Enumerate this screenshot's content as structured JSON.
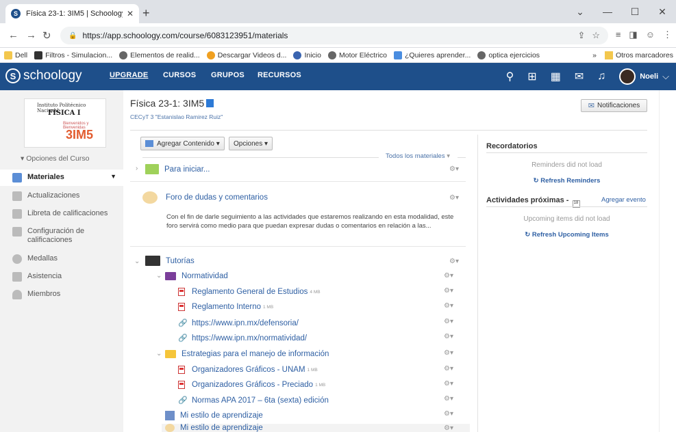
{
  "browser": {
    "tab_title": "Física 23-1: 3IM5 | Schoology",
    "tab_favicon": "S",
    "url": "https://app.schoology.com/course/6083123951/materials",
    "bookmarks": [
      "Dell",
      "Filtros - Simulacion...",
      "Elementos de realid...",
      "Descargar Videos d...",
      "Inicio",
      "Motor Eléctrico",
      "¿Quieres aprender...",
      "optica ejercicios"
    ],
    "other_bookmarks": "Otros marcadores",
    "more": "»"
  },
  "nav": {
    "logo": "schoology",
    "links": [
      "UPGRADE",
      "CURSOS",
      "GRUPOS",
      "RECURSOS"
    ],
    "user": "Noeli"
  },
  "colors": {
    "nav_bg": "#1e4f8a",
    "link": "#2e5fa3",
    "sidebar_bg": "#f2f2f2"
  },
  "sidebar": {
    "course_pic": {
      "line1": "Instituto Politécnico Nacional",
      "line2": "FÍSICA I",
      "line3": "Bienvenidos y Bienvenidas",
      "line4": "3IM5"
    },
    "options": "Opciones del Curso",
    "items": [
      {
        "label": "Materiales",
        "icon": "materials-icon"
      },
      {
        "label": "Actualizaciones",
        "icon": "updates-icon"
      },
      {
        "label": "Libreta de calificaciones",
        "icon": "gradebook-icon"
      },
      {
        "label": "Configuración de calificaciones",
        "icon": "grade-settings-icon"
      },
      {
        "label": "Medallas",
        "icon": "badge-icon"
      },
      {
        "label": "Asistencia",
        "icon": "attendance-icon"
      },
      {
        "label": "Miembros",
        "icon": "members-icon"
      }
    ]
  },
  "course": {
    "title": "Física 23-1: 3IM5",
    "school": "CECyT 3 \"Estanislao Ramirez Ruiz\"",
    "notifications": "Notificaciones",
    "add_content": "Agregar Contenido",
    "options": "Opciones",
    "filter": "Todos los materiales"
  },
  "materials": {
    "para_iniciar": "Para iniciar...",
    "foro_title": "Foro de dudas y comentarios",
    "foro_desc": "Con el fin de darle seguimiento a las actividades que estaremos realizando en esta modalidad, este foro servirá como medio para que puedan expresar dudas o comentarios en relación a las...",
    "tutorias": "Tutorías",
    "normatividad": "Normatividad",
    "norm_items": [
      {
        "title": "Reglamento General de Estudios",
        "size": "4 MB"
      },
      {
        "title": "Reglamento Interno",
        "size": "1 MB"
      },
      {
        "title": "https://www.ipn.mx/defensoria/",
        "size": ""
      },
      {
        "title": "https://www.ipn.mx/normatividad/",
        "size": ""
      }
    ],
    "estrategias": "Estrategias para el manejo de información",
    "est_items": [
      {
        "title": "Organizadores Gráficos - UNAM",
        "size": "1 MB"
      },
      {
        "title": "Organizadores Gráficos - Preciado",
        "size": "1 MB"
      },
      {
        "title": "Normas APA 2017 – 6ta (sexta) edición",
        "size": ""
      }
    ],
    "estilo1": "Mi estilo de aprendizaje",
    "estilo2": "Mi estilo de aprendizaje"
  },
  "right": {
    "reminders_title": "Recordatorios",
    "reminders_msg": "Reminders did not load",
    "refresh_reminders": "Refresh Reminders",
    "upcoming_title": "Actividades próximas -",
    "cal_day": "18",
    "add_event": "Agregar evento",
    "upcoming_msg": "Upcoming items did not load",
    "refresh_upcoming": "Refresh Upcoming Items"
  }
}
